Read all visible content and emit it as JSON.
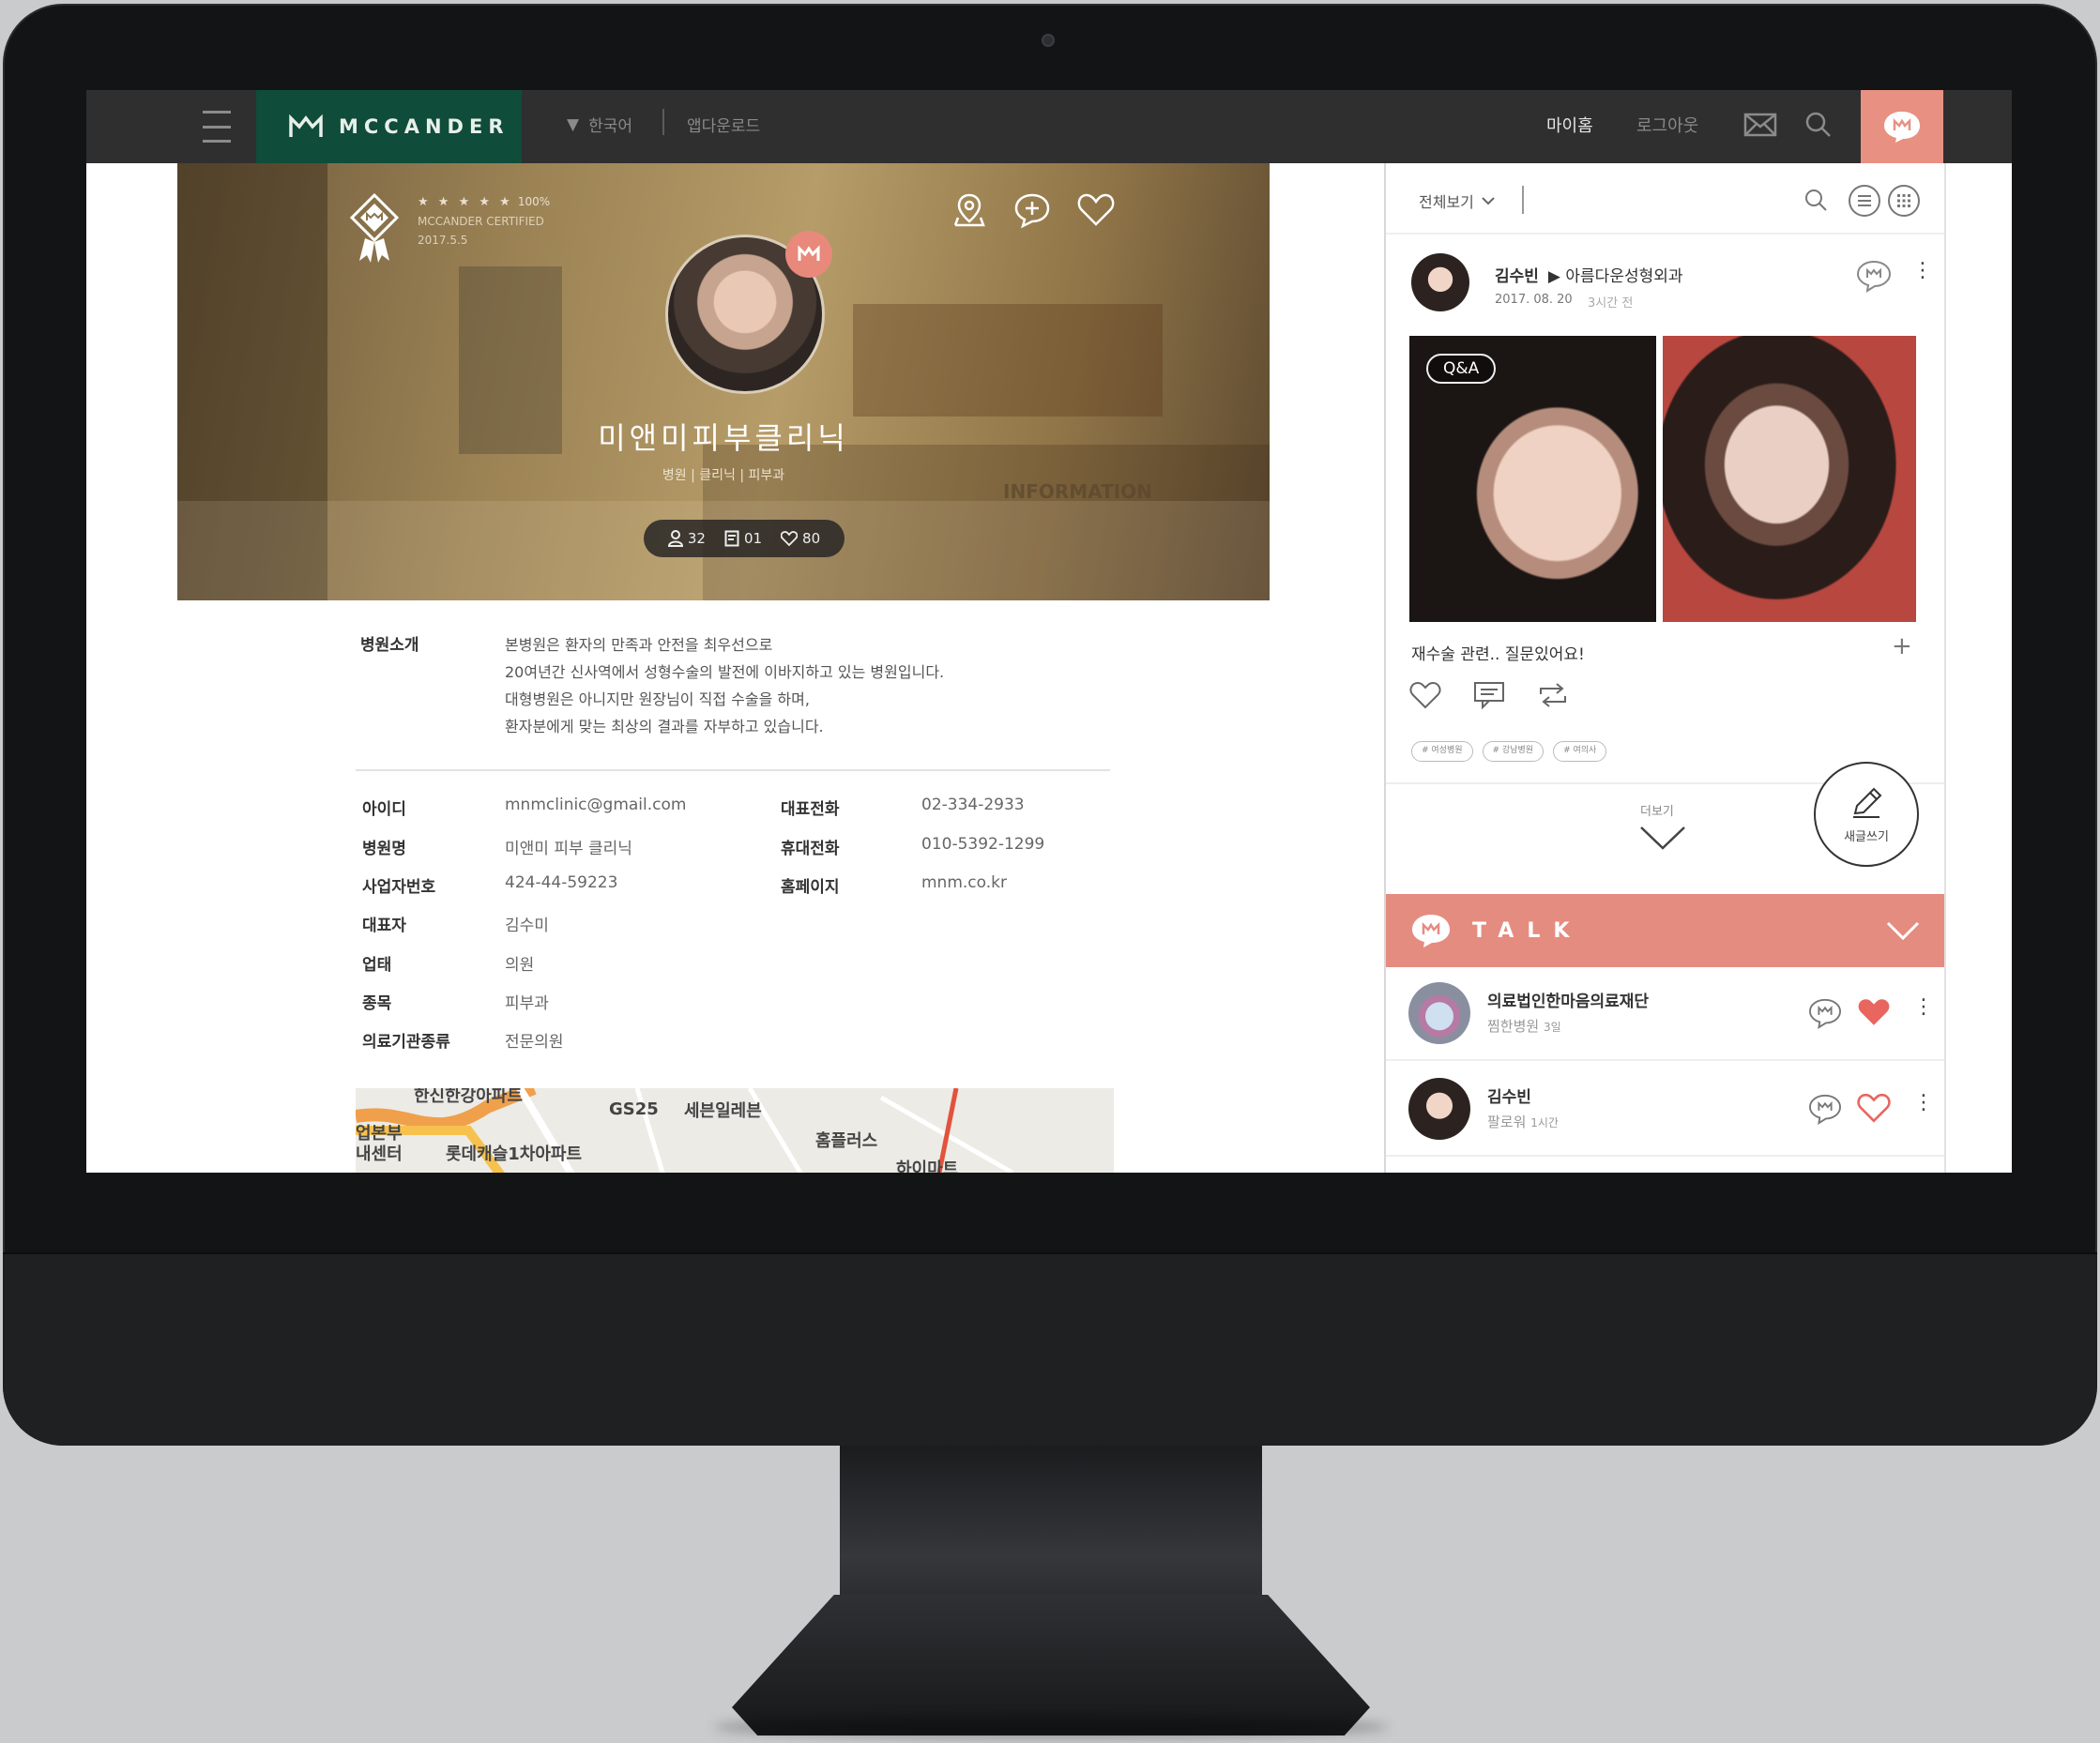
{
  "nav": {
    "brand": "MCCANDER",
    "language": "한국어",
    "app_download": "앱다운로드",
    "my_home": "마이홈",
    "logout": "로그아웃"
  },
  "hero": {
    "stars": "★ ★ ★ ★ ★",
    "rating": "100%",
    "certified": "MCCANDER CERTIFIED",
    "cert_date": "2017.5.5",
    "clinic_name": "미앤미피부클리닉",
    "categories": "병원 | 클리닉 | 피부과",
    "watermark": "INFORMATION",
    "stats": {
      "followers": "32",
      "posts": "01",
      "likes": "80"
    }
  },
  "intro": {
    "label": "병원소개",
    "lines": [
      "본병원은 환자의 만족과 안전을 최우선으로",
      "20여년간 신사역에서 성형수술의 발전에 이바지하고 있는 병원입니다.",
      "대형병원은 아니지만 원장님이 직접 수술을 하며,",
      "환자분에게 맞는 최상의 결과를 자부하고 있습니다."
    ]
  },
  "info": {
    "left": [
      {
        "label": "아이디",
        "value": "mnmclinic@gmail.com"
      },
      {
        "label": "병원명",
        "value": "미앤미 피부 클리닉"
      },
      {
        "label": "사업자번호",
        "value": "424-44-59223"
      },
      {
        "label": "대표자",
        "value": "김수미"
      },
      {
        "label": "업태",
        "value": "의원"
      },
      {
        "label": "종목",
        "value": "피부과"
      },
      {
        "label": "의료기관종류",
        "value": "전문의원"
      }
    ],
    "right": [
      {
        "label": "대표전화",
        "value": "02-334-2933"
      },
      {
        "label": "휴대전화",
        "value": "010-5392-1299"
      },
      {
        "label": "홈페이지",
        "value": "mnm.co.kr"
      }
    ]
  },
  "map": {
    "labels": [
      "한신한강아파트",
      "GS25",
      "세븐일레븐",
      "홈플러스",
      "업본부",
      "내센터",
      "롯데캐슬1차아파트",
      "하이마트"
    ]
  },
  "feed": {
    "filter": "전체보기",
    "post": {
      "author": "김수빈",
      "target": "▶ 아름다운성형외과",
      "date": "2017. 08. 20",
      "ago": "3시간 전",
      "tag_label": "Q&A",
      "text": "재수술 관련.. 질문있어요!",
      "tags": [
        "# 여성병원",
        "# 강남병원",
        "# 여의사"
      ]
    },
    "more": "더보기",
    "write": "새글쓰기"
  },
  "talk": {
    "title": "TALK",
    "items": [
      {
        "name": "의료법인한마음의료재단",
        "sub": "찜한병원",
        "time": "3일"
      },
      {
        "name": "김수빈",
        "sub": "팔로워",
        "time": "1시간"
      }
    ]
  },
  "colors": {
    "accent": "#e58c80",
    "brand_green": "#0f4c3a",
    "topbar": "#2f2f30"
  }
}
